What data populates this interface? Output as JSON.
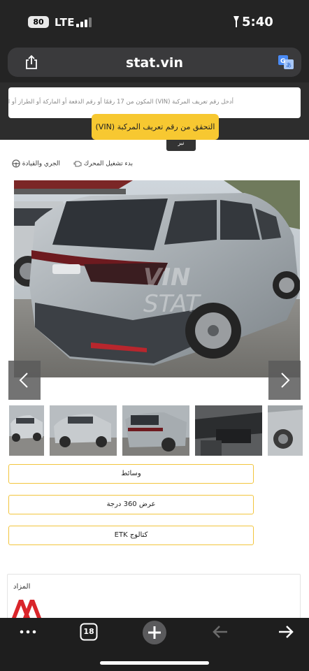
{
  "status_bar": {
    "battery": "80",
    "network": "LTE",
    "time": "5:40"
  },
  "browser": {
    "url": "stat.vin",
    "tab_count": "18",
    "icons": [
      "share-icon",
      "translate-icon",
      "more-icon",
      "tabs-icon",
      "new-tab-icon",
      "back-icon",
      "forward-icon"
    ]
  },
  "search": {
    "placeholder": "أدخل رقم تعريف المركبة (VIN) المكون من 17 رقمًا أو رقم الدفعة أو الماركة أو الطراز أو السنة",
    "button_label": "التحقق من رقم تعريف المركبة (VIN)",
    "tab_label": "نبر"
  },
  "features": [
    {
      "label": "بدء تشغيل المحرك",
      "icon": "engine-icon"
    },
    {
      "label": "الجري والقيادة",
      "icon": "steering-wheel-icon"
    }
  ],
  "gallery": {
    "watermark": "VIN STAT",
    "thumbnail_count": 5
  },
  "buttons": {
    "media": "وسائط",
    "view360": "عرض 360 درجة",
    "catalog": "كتالوج ETK"
  },
  "auction": {
    "label": "المزاد"
  },
  "colors": {
    "accent": "#f7c831",
    "browser_bar": "#242424",
    "auction_logo": "#d9252a"
  }
}
